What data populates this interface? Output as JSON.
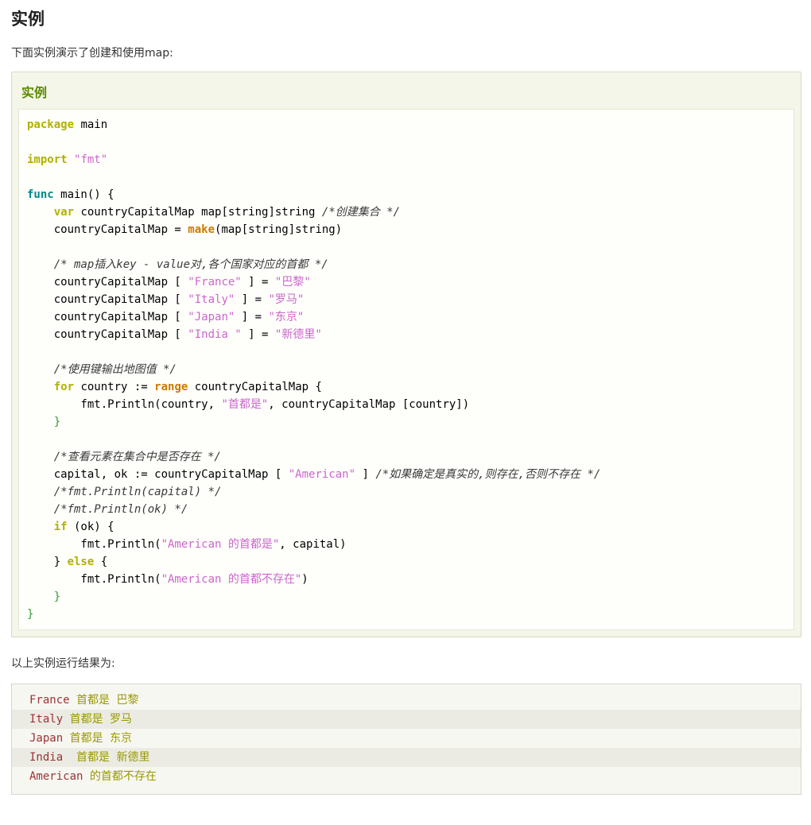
{
  "page": {
    "heading": "实例",
    "intro": "下面实例演示了创建和使用map:",
    "result_label": "以上实例运行结果为:"
  },
  "colors": {
    "example_title_green": "#5c8a00",
    "keyword": "#b1b100",
    "func_keyword": "#008b8b",
    "builtin": "#cc7a00",
    "string": "#cc66cc",
    "comment": "#3a3a3a",
    "symbol": "#339933",
    "output_english": "#993333",
    "output_chinese": "#999900"
  },
  "example": {
    "title": "实例",
    "language": "go",
    "code_lines": [
      [
        {
          "t": "package",
          "c": "kw"
        },
        {
          "t": " main",
          "c": ""
        }
      ],
      [],
      [
        {
          "t": "import",
          "c": "kw"
        },
        {
          "t": " ",
          "c": ""
        },
        {
          "t": "\"fmt\"",
          "c": "str"
        }
      ],
      [],
      [
        {
          "t": "func",
          "c": "fnk"
        },
        {
          "t": " main() {",
          "c": ""
        }
      ],
      [
        {
          "t": "    ",
          "c": ""
        },
        {
          "t": "var",
          "c": "kw"
        },
        {
          "t": " countryCapitalMap map[string]string ",
          "c": ""
        },
        {
          "t": "/*创建集合 */",
          "c": "cmt"
        }
      ],
      [
        {
          "t": "    countryCapitalMap = ",
          "c": ""
        },
        {
          "t": "make",
          "c": "bi"
        },
        {
          "t": "(map[string]string)",
          "c": ""
        }
      ],
      [],
      [
        {
          "t": "    ",
          "c": ""
        },
        {
          "t": "/* map插入key - value对,各个国家对应的首都 */",
          "c": "cmt"
        }
      ],
      [
        {
          "t": "    countryCapitalMap [ ",
          "c": ""
        },
        {
          "t": "\"France\"",
          "c": "str"
        },
        {
          "t": " ] = ",
          "c": ""
        },
        {
          "t": "\"巴黎\"",
          "c": "str"
        }
      ],
      [
        {
          "t": "    countryCapitalMap [ ",
          "c": ""
        },
        {
          "t": "\"Italy\"",
          "c": "str"
        },
        {
          "t": " ] = ",
          "c": ""
        },
        {
          "t": "\"罗马\"",
          "c": "str"
        }
      ],
      [
        {
          "t": "    countryCapitalMap [ ",
          "c": ""
        },
        {
          "t": "\"Japan\"",
          "c": "str"
        },
        {
          "t": " ] = ",
          "c": ""
        },
        {
          "t": "\"东京\"",
          "c": "str"
        }
      ],
      [
        {
          "t": "    countryCapitalMap [ ",
          "c": ""
        },
        {
          "t": "\"India \"",
          "c": "str"
        },
        {
          "t": " ] = ",
          "c": ""
        },
        {
          "t": "\"新德里\"",
          "c": "str"
        }
      ],
      [],
      [
        {
          "t": "    ",
          "c": ""
        },
        {
          "t": "/*使用键输出地图值 */",
          "c": "cmt"
        }
      ],
      [
        {
          "t": "    ",
          "c": ""
        },
        {
          "t": "for",
          "c": "kw"
        },
        {
          "t": " country := ",
          "c": ""
        },
        {
          "t": "range",
          "c": "bi"
        },
        {
          "t": " countryCapitalMap {",
          "c": ""
        }
      ],
      [
        {
          "t": "        fmt.Println(country, ",
          "c": ""
        },
        {
          "t": "\"首都是\"",
          "c": "str"
        },
        {
          "t": ", countryCapitalMap [country])",
          "c": ""
        }
      ],
      [
        {
          "t": "    ",
          "c": ""
        },
        {
          "t": "}",
          "c": "sym"
        }
      ],
      [],
      [
        {
          "t": "    ",
          "c": ""
        },
        {
          "t": "/*查看元素在集合中是否存在 */",
          "c": "cmt"
        }
      ],
      [
        {
          "t": "    capital, ok := countryCapitalMap [ ",
          "c": ""
        },
        {
          "t": "\"American\"",
          "c": "str"
        },
        {
          "t": " ] ",
          "c": ""
        },
        {
          "t": "/*如果确定是真实的,则存在,否则不存在 */",
          "c": "cmt"
        }
      ],
      [
        {
          "t": "    ",
          "c": ""
        },
        {
          "t": "/*fmt.Println(capital) */",
          "c": "cmt"
        }
      ],
      [
        {
          "t": "    ",
          "c": ""
        },
        {
          "t": "/*fmt.Println(ok) */",
          "c": "cmt"
        }
      ],
      [
        {
          "t": "    ",
          "c": ""
        },
        {
          "t": "if",
          "c": "kw"
        },
        {
          "t": " (ok) {",
          "c": ""
        }
      ],
      [
        {
          "t": "        fmt.Println(",
          "c": ""
        },
        {
          "t": "\"American 的首都是\"",
          "c": "str"
        },
        {
          "t": ", capital)",
          "c": ""
        }
      ],
      [
        {
          "t": "    } ",
          "c": ""
        },
        {
          "t": "else",
          "c": "kw"
        },
        {
          "t": " {",
          "c": ""
        }
      ],
      [
        {
          "t": "        fmt.Println(",
          "c": ""
        },
        {
          "t": "\"American 的首都不存在\"",
          "c": "str"
        },
        {
          "t": ")",
          "c": ""
        }
      ],
      [
        {
          "t": "    ",
          "c": ""
        },
        {
          "t": "}",
          "c": "sym"
        }
      ],
      [
        {
          "t": "}",
          "c": "sym"
        }
      ]
    ]
  },
  "output": {
    "lines": [
      [
        {
          "t": "France ",
          "c": "oen"
        },
        {
          "t": "首都是 巴黎",
          "c": "ozh"
        }
      ],
      [
        {
          "t": "Italy ",
          "c": "oen"
        },
        {
          "t": "首都是 罗马",
          "c": "ozh"
        }
      ],
      [
        {
          "t": "Japan ",
          "c": "oen"
        },
        {
          "t": "首都是 东京",
          "c": "ozh"
        }
      ],
      [
        {
          "t": "India  ",
          "c": "oen"
        },
        {
          "t": "首都是 新德里",
          "c": "ozh"
        }
      ],
      [
        {
          "t": "American ",
          "c": "oen"
        },
        {
          "t": "的首都不存在",
          "c": "ozh"
        }
      ]
    ]
  }
}
